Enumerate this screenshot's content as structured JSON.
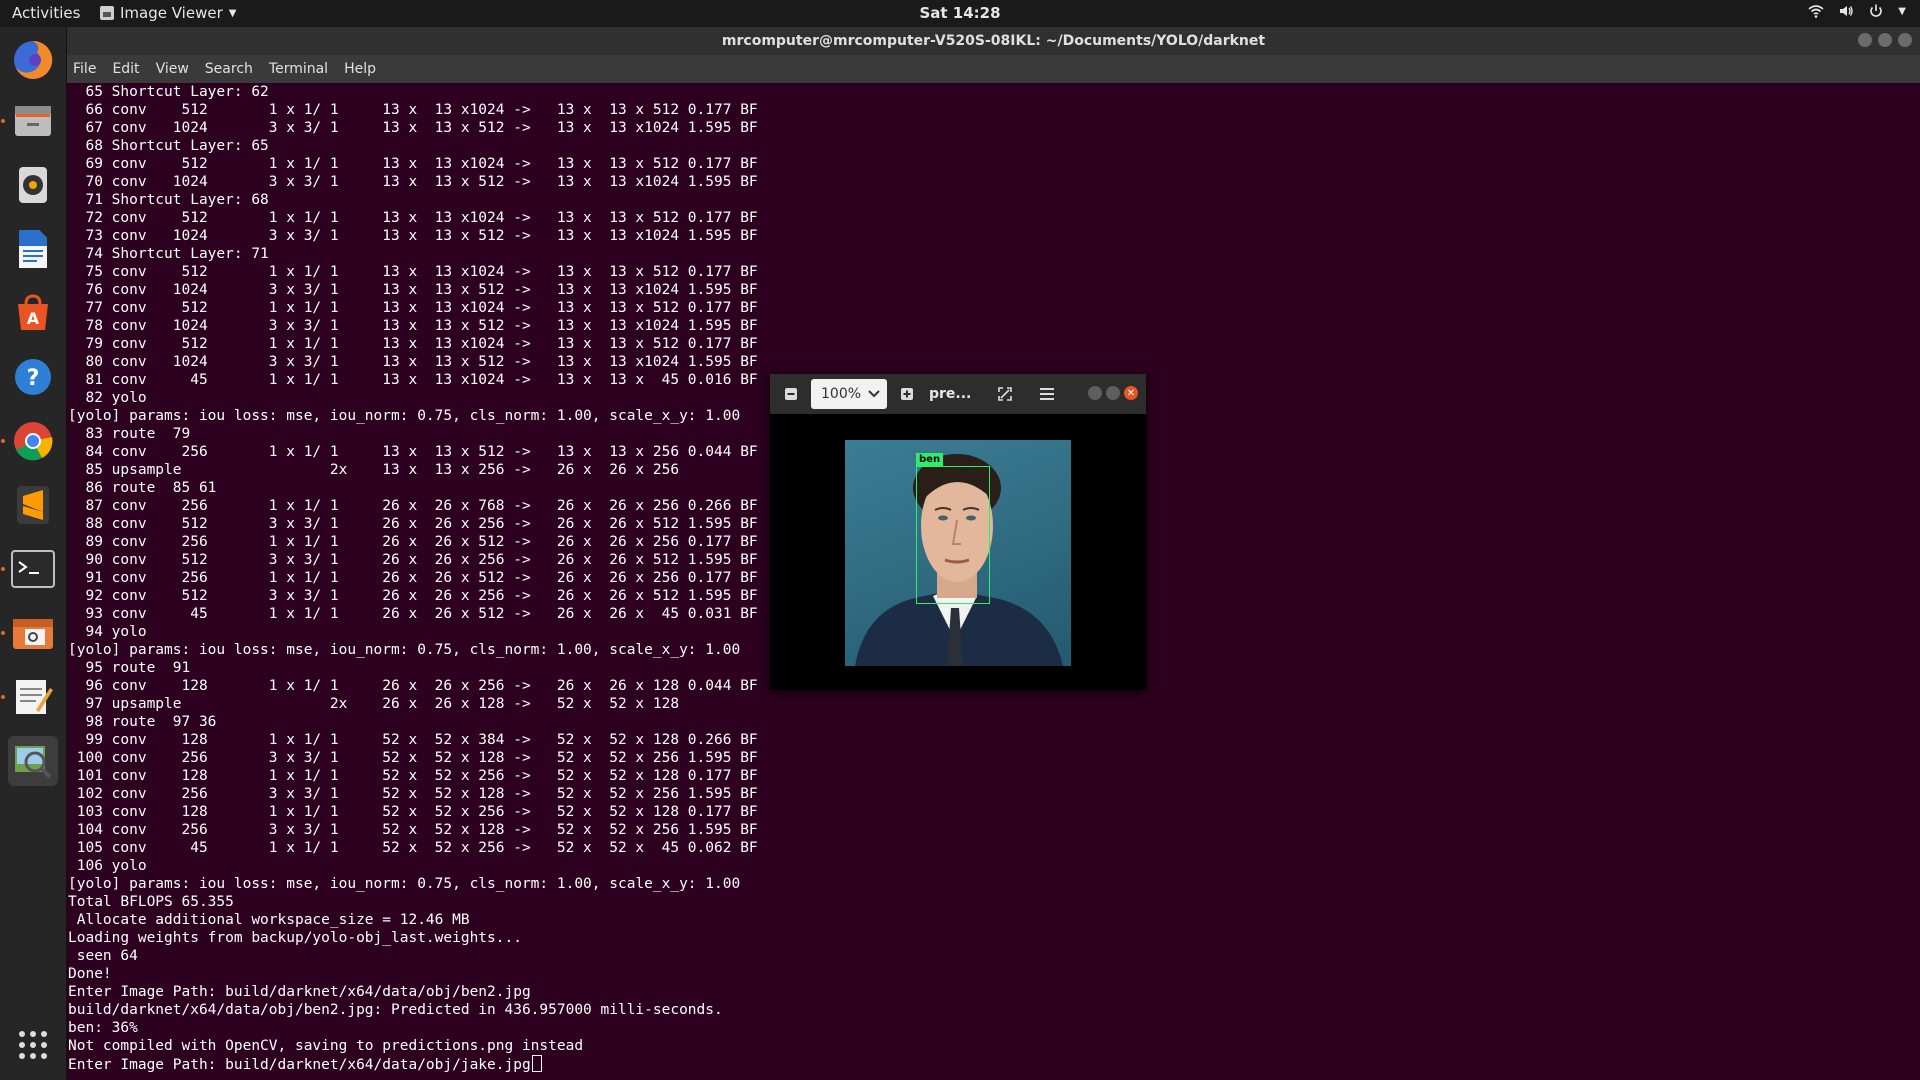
{
  "topbar": {
    "activities": "Activities",
    "app_menu": "Image Viewer",
    "clock": "Sat 14:28"
  },
  "dock": {
    "items": [
      "firefox-icon",
      "files-icon",
      "rhythmbox-icon",
      "writer-icon",
      "software-icon",
      "help-icon",
      "chrome-icon",
      "sublime-icon",
      "terminal-icon",
      "archive-icon",
      "text-editor-icon",
      "image-viewer-icon",
      "app-grid-icon"
    ]
  },
  "terminal": {
    "title": "mrcomputer@mrcomputer-V520S-08IKL: ~/Documents/YOLO/darknet",
    "menu": [
      "File",
      "Edit",
      "View",
      "Search",
      "Terminal",
      "Help"
    ],
    "lines": [
      "  65 Shortcut Layer: 62",
      "  66 conv    512       1 x 1/ 1     13 x  13 x1024 ->   13 x  13 x 512 0.177 BF",
      "  67 conv   1024       3 x 3/ 1     13 x  13 x 512 ->   13 x  13 x1024 1.595 BF",
      "  68 Shortcut Layer: 65",
      "  69 conv    512       1 x 1/ 1     13 x  13 x1024 ->   13 x  13 x 512 0.177 BF",
      "  70 conv   1024       3 x 3/ 1     13 x  13 x 512 ->   13 x  13 x1024 1.595 BF",
      "  71 Shortcut Layer: 68",
      "  72 conv    512       1 x 1/ 1     13 x  13 x1024 ->   13 x  13 x 512 0.177 BF",
      "  73 conv   1024       3 x 3/ 1     13 x  13 x 512 ->   13 x  13 x1024 1.595 BF",
      "  74 Shortcut Layer: 71",
      "  75 conv    512       1 x 1/ 1     13 x  13 x1024 ->   13 x  13 x 512 0.177 BF",
      "  76 conv   1024       3 x 3/ 1     13 x  13 x 512 ->   13 x  13 x1024 1.595 BF",
      "  77 conv    512       1 x 1/ 1     13 x  13 x1024 ->   13 x  13 x 512 0.177 BF",
      "  78 conv   1024       3 x 3/ 1     13 x  13 x 512 ->   13 x  13 x1024 1.595 BF",
      "  79 conv    512       1 x 1/ 1     13 x  13 x1024 ->   13 x  13 x 512 0.177 BF",
      "  80 conv   1024       3 x 3/ 1     13 x  13 x 512 ->   13 x  13 x1024 1.595 BF",
      "  81 conv     45       1 x 1/ 1     13 x  13 x1024 ->   13 x  13 x  45 0.016 BF",
      "  82 yolo",
      "[yolo] params: iou loss: mse, iou_norm: 0.75, cls_norm: 1.00, scale_x_y: 1.00",
      "  83 route  79",
      "  84 conv    256       1 x 1/ 1     13 x  13 x 512 ->   13 x  13 x 256 0.044 BF",
      "  85 upsample                 2x    13 x  13 x 256 ->   26 x  26 x 256",
      "  86 route  85 61",
      "  87 conv    256       1 x 1/ 1     26 x  26 x 768 ->   26 x  26 x 256 0.266 BF",
      "  88 conv    512       3 x 3/ 1     26 x  26 x 256 ->   26 x  26 x 512 1.595 BF",
      "  89 conv    256       1 x 1/ 1     26 x  26 x 512 ->   26 x  26 x 256 0.177 BF",
      "  90 conv    512       3 x 3/ 1     26 x  26 x 256 ->   26 x  26 x 512 1.595 BF",
      "  91 conv    256       1 x 1/ 1     26 x  26 x 512 ->   26 x  26 x 256 0.177 BF",
      "  92 conv    512       3 x 3/ 1     26 x  26 x 256 ->   26 x  26 x 512 1.595 BF",
      "  93 conv     45       1 x 1/ 1     26 x  26 x 512 ->   26 x  26 x  45 0.031 BF",
      "  94 yolo",
      "[yolo] params: iou loss: mse, iou_norm: 0.75, cls_norm: 1.00, scale_x_y: 1.00",
      "  95 route  91",
      "  96 conv    128       1 x 1/ 1     26 x  26 x 256 ->   26 x  26 x 128 0.044 BF",
      "  97 upsample                 2x    26 x  26 x 128 ->   52 x  52 x 128",
      "  98 route  97 36",
      "  99 conv    128       1 x 1/ 1     52 x  52 x 384 ->   52 x  52 x 128 0.266 BF",
      " 100 conv    256       3 x 3/ 1     52 x  52 x 128 ->   52 x  52 x 256 1.595 BF",
      " 101 conv    128       1 x 1/ 1     52 x  52 x 256 ->   52 x  52 x 128 0.177 BF",
      " 102 conv    256       3 x 3/ 1     52 x  52 x 128 ->   52 x  52 x 256 1.595 BF",
      " 103 conv    128       1 x 1/ 1     52 x  52 x 256 ->   52 x  52 x 128 0.177 BF",
      " 104 conv    256       3 x 3/ 1     52 x  52 x 128 ->   52 x  52 x 256 1.595 BF",
      " 105 conv     45       1 x 1/ 1     52 x  52 x 256 ->   52 x  52 x  45 0.062 BF",
      " 106 yolo",
      "[yolo] params: iou loss: mse, iou_norm: 0.75, cls_norm: 1.00, scale_x_y: 1.00",
      "Total BFLOPS 65.355",
      " Allocate additional workspace_size = 12.46 MB",
      "Loading weights from backup/yolo-obj_last.weights...",
      " seen 64",
      "Done!",
      "Enter Image Path: build/darknet/x64/data/obj/ben2.jpg",
      "build/darknet/x64/data/obj/ben2.jpg: Predicted in 436.957000 milli-seconds.",
      "ben: 36%",
      "Not compiled with OpenCV, saving to predictions.png instead",
      "Enter Image Path: build/darknet/x64/data/obj/jake.jpg"
    ]
  },
  "viewer": {
    "zoom": "100%",
    "title": "pre...",
    "detection_label": "ben"
  },
  "colors": {
    "terminal_bg": "#2c001e",
    "bbox": "#2cf06a",
    "close": "#e95420"
  }
}
